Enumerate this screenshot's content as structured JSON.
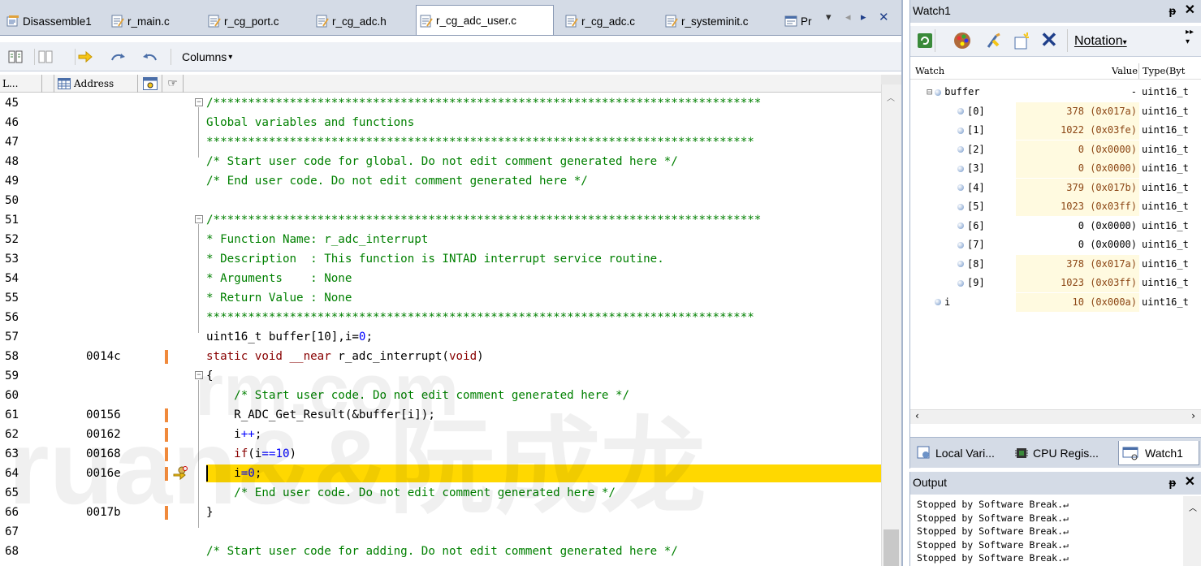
{
  "editor": {
    "tabs": [
      {
        "label": "Disassemble1",
        "active": false
      },
      {
        "label": "r_main.c",
        "active": false
      },
      {
        "label": "r_cg_port.c",
        "active": false
      },
      {
        "label": "r_cg_adc.h",
        "active": false
      },
      {
        "label": "r_cg_adc_user.c",
        "active": true
      },
      {
        "label": "r_cg_adc.c",
        "active": false
      },
      {
        "label": "r_systeminit.c",
        "active": false
      },
      {
        "label": "Pr",
        "active": false
      }
    ],
    "toolbar": {
      "columns_label": "Columns"
    },
    "column_headers": {
      "line": "L...",
      "address": "Address"
    },
    "lines": [
      {
        "n": "45",
        "addr": "",
        "code": "/*******************************************************************************",
        "cls": "cmt",
        "mark": false
      },
      {
        "n": "46",
        "addr": "",
        "code": "Global variables and functions",
        "cls": "cmt",
        "mark": false
      },
      {
        "n": "47",
        "addr": "",
        "code": "*******************************************************************************",
        "cls": "cmt",
        "mark": false
      },
      {
        "n": "48",
        "addr": "",
        "code": "/* Start user code for global. Do not edit comment generated here */",
        "cls": "cmt",
        "mark": false
      },
      {
        "n": "49",
        "addr": "",
        "code": "/* End user code. Do not edit comment generated here */",
        "cls": "cmt",
        "mark": false
      },
      {
        "n": "50",
        "addr": "",
        "code": "",
        "cls": "",
        "mark": false
      },
      {
        "n": "51",
        "addr": "",
        "code": "/*******************************************************************************",
        "cls": "cmt",
        "mark": false
      },
      {
        "n": "52",
        "addr": "",
        "code": "* Function Name: r_adc_interrupt",
        "cls": "cmt",
        "mark": false
      },
      {
        "n": "53",
        "addr": "",
        "code": "* Description  : This function is INTAD interrupt service routine.",
        "cls": "cmt",
        "mark": false
      },
      {
        "n": "54",
        "addr": "",
        "code": "* Arguments    : None",
        "cls": "cmt",
        "mark": false
      },
      {
        "n": "55",
        "addr": "",
        "code": "* Return Value : None",
        "cls": "cmt",
        "mark": false
      },
      {
        "n": "56",
        "addr": "",
        "code": "*******************************************************************************",
        "cls": "cmt",
        "mark": false
      },
      {
        "n": "57",
        "addr": "",
        "code": "uint16_t buffer[10],i=0;",
        "cls": "",
        "mark": false
      },
      {
        "n": "58",
        "addr": "0014c",
        "code": "static void __near r_adc_interrupt(void)",
        "cls": "",
        "mark": true
      },
      {
        "n": "59",
        "addr": "",
        "code": "{",
        "cls": "",
        "mark": false
      },
      {
        "n": "60",
        "addr": "",
        "code": "    /* Start user code. Do not edit comment generated here */",
        "cls": "cmt",
        "mark": false
      },
      {
        "n": "61",
        "addr": "00156",
        "code": "    R_ADC_Get_Result(&buffer[i]);",
        "cls": "",
        "mark": true
      },
      {
        "n": "62",
        "addr": "00162",
        "code": "    i++;",
        "cls": "",
        "mark": true
      },
      {
        "n": "63",
        "addr": "00168",
        "code": "    if(i==10)",
        "cls": "",
        "mark": true
      },
      {
        "n": "64",
        "addr": "0016e",
        "code": "    i=0;",
        "cls": "",
        "mark": true
      },
      {
        "n": "65",
        "addr": "",
        "code": "    /* End user code. Do not edit comment generated here */",
        "cls": "cmt",
        "mark": false
      },
      {
        "n": "66",
        "addr": "0017b",
        "code": "}",
        "cls": "",
        "mark": true
      },
      {
        "n": "67",
        "addr": "",
        "code": "",
        "cls": "",
        "mark": false
      },
      {
        "n": "68",
        "addr": "",
        "code": "/* Start user code for adding. Do not edit comment generated here */",
        "cls": "cmt",
        "mark": false
      }
    ],
    "highlight_color": "#ffd800",
    "watermark": "ruan&&阮成龙  .com"
  },
  "watch": {
    "title": "Watch1",
    "notation_label": "Notation",
    "col_watch": "Watch",
    "col_value": "Value",
    "col_type": "Type(Byt",
    "rows": [
      {
        "name": "buffer",
        "value": "-",
        "type": "uint16_t",
        "root": true,
        "changed": false
      },
      {
        "name": "[0]",
        "value": "378 (0x017a)",
        "type": "uint16_t",
        "root": false,
        "changed": true
      },
      {
        "name": "[1]",
        "value": "1022 (0x03fe)",
        "type": "uint16_t",
        "root": false,
        "changed": true
      },
      {
        "name": "[2]",
        "value": "0 (0x0000)",
        "type": "uint16_t",
        "root": false,
        "changed": true
      },
      {
        "name": "[3]",
        "value": "0 (0x0000)",
        "type": "uint16_t",
        "root": false,
        "changed": true
      },
      {
        "name": "[4]",
        "value": "379 (0x017b)",
        "type": "uint16_t",
        "root": false,
        "changed": true
      },
      {
        "name": "[5]",
        "value": "1023 (0x03ff)",
        "type": "uint16_t",
        "root": false,
        "changed": true
      },
      {
        "name": "[6]",
        "value": "0 (0x0000)",
        "type": "uint16_t",
        "root": false,
        "changed": false
      },
      {
        "name": "[7]",
        "value": "0 (0x0000)",
        "type": "uint16_t",
        "root": false,
        "changed": false
      },
      {
        "name": "[8]",
        "value": "378 (0x017a)",
        "type": "uint16_t",
        "root": false,
        "changed": true
      },
      {
        "name": "[9]",
        "value": "1023 (0x03ff)",
        "type": "uint16_t",
        "root": false,
        "changed": true
      },
      {
        "name": "i",
        "value": "10 (0x000a)",
        "type": "uint16_t",
        "root": true,
        "changed": true
      }
    ],
    "bottom_tabs": [
      "Local Vari...",
      "CPU Regis...",
      "Watch1"
    ]
  },
  "output": {
    "title": "Output",
    "lines": [
      "Stopped by Software Break.↵",
      "Stopped by Software Break.↵",
      "Stopped by Software Break.↵",
      "Stopped by Software Break.↵",
      "Stopped by Software Break.↵"
    ]
  }
}
